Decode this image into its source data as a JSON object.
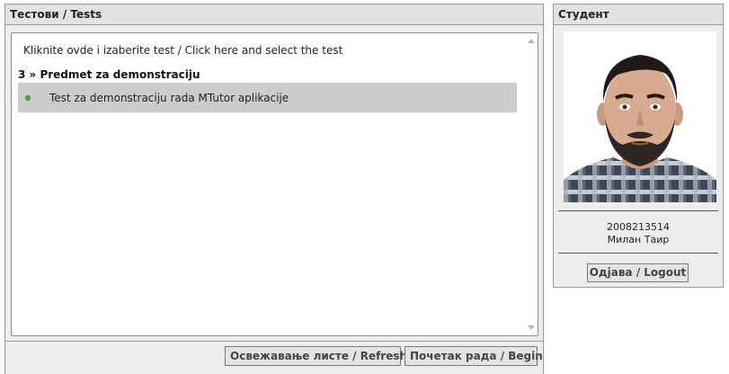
{
  "tests_panel": {
    "title": "Тестови / Tests",
    "hint": "Kliknite ovde i izaberite test / Click here and select the test",
    "subject": "3 » Predmet za demonstraciju",
    "tests": [
      {
        "name": "Test za demonstraciju rada MTutor aplikacije",
        "status": "green",
        "selected": true
      }
    ],
    "buttons": {
      "refresh": "Освежавање листе / Refresh",
      "begin": "Почетак рада / Begin"
    }
  },
  "student_panel": {
    "title": "Студент",
    "student_id": "2008213514",
    "student_name": "Милан Таир",
    "logout": "Одјава / Logout"
  },
  "colors": {
    "panel_bg": "#ededed",
    "header_bg": "#e2e2e2",
    "selected_row_bg": "#cccccc",
    "status_green": "#3fb24a"
  }
}
